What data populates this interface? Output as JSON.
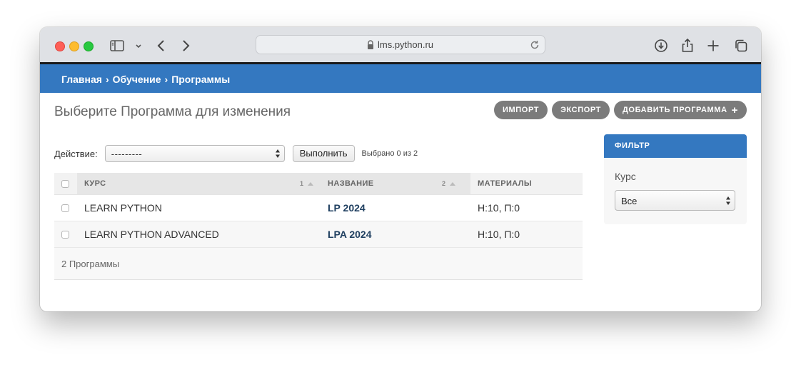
{
  "browser": {
    "url": "lms.python.ru"
  },
  "breadcrumbs": {
    "home": "Главная",
    "separator": "›",
    "section": "Обучение",
    "current": "Программы"
  },
  "page": {
    "title": "Выберите Программа для изменения"
  },
  "tools": {
    "import_label": "ИМПОРТ",
    "export_label": "ЭКСПОРТ",
    "add_label": "ДОБАВИТЬ ПРОГРАММА",
    "add_icon": "+"
  },
  "actions": {
    "label": "Действие:",
    "selected": "---------",
    "go_label": "Выполнить",
    "counter": "Выбрано 0 из 2"
  },
  "table": {
    "columns": [
      {
        "label": "КУРС",
        "sort_priority": "1"
      },
      {
        "label": "НАЗВАНИЕ",
        "sort_priority": "2"
      },
      {
        "label": "МАТЕРИАЛЫ"
      }
    ],
    "rows": [
      {
        "course": "LEARN PYTHON",
        "name": "LP 2024",
        "materials": "Н:10, П:0"
      },
      {
        "course": "LEARN PYTHON ADVANCED",
        "name": "LPA 2024",
        "materials": "Н:10, П:0"
      }
    ],
    "footer": "2 Программы"
  },
  "filter": {
    "title": "ФИЛЬТР",
    "field_label": "Курс",
    "selected": "Все"
  },
  "colors": {
    "header_blue": "#3478c0",
    "tool_button": "#7b7b7b",
    "link": "#1f3f60"
  }
}
